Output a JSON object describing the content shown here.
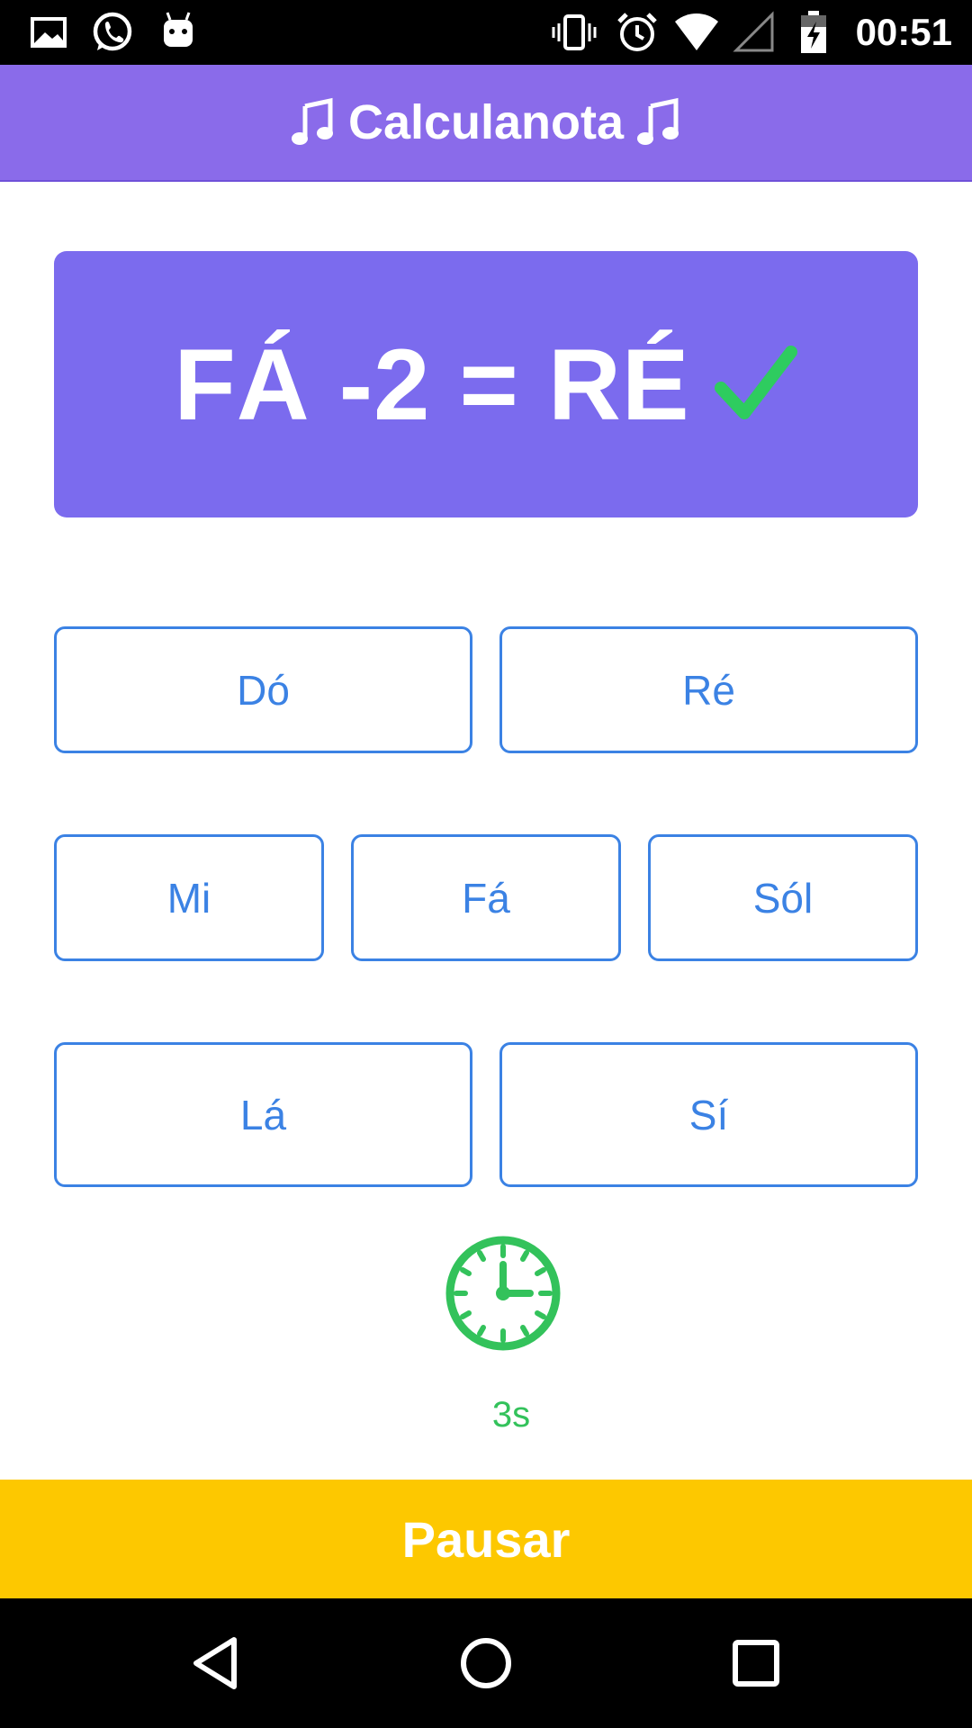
{
  "status_bar": {
    "time": "00:51",
    "icons": [
      "image-icon",
      "whatsapp-icon",
      "android-icon",
      "vibrate-icon",
      "alarm-icon",
      "wifi-icon",
      "signal-icon",
      "battery-charging-icon"
    ]
  },
  "app_bar": {
    "title": "Calculanota",
    "icon_left": "music-note-icon",
    "icon_right": "music-note-icon",
    "background": "#8a6bea"
  },
  "result": {
    "text": "FÁ -2 = RÉ",
    "status_icon": "check-icon",
    "status": "correct",
    "background": "#7b6bee",
    "check_color": "#2ecc5f"
  },
  "notes": {
    "do": "Dó",
    "re": "Ré",
    "mi": "Mi",
    "fa": "Fá",
    "sol": "Sól",
    "la": "Lá",
    "si": "Sí",
    "accent": "#3b82e4"
  },
  "timer": {
    "icon": "clock-icon",
    "value": "3s",
    "color": "#33c25b"
  },
  "pause": {
    "label": "Pausar",
    "background": "#fdc800"
  },
  "nav_bar": {
    "buttons": [
      "back-icon",
      "home-icon",
      "recents-icon"
    ]
  }
}
